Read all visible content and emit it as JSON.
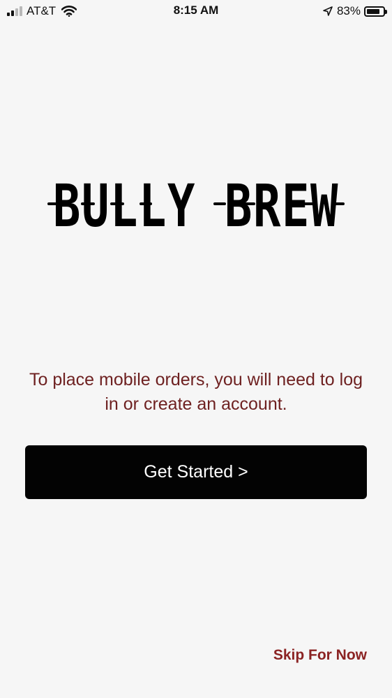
{
  "status_bar": {
    "carrier": "AT&T",
    "time": "8:15 AM",
    "battery_percent": "83%",
    "battery_level": 0.83,
    "signal_bars_active": 2,
    "signal_bars_total": 4,
    "icons": [
      "signal-icon",
      "wifi-icon",
      "location-arrow-icon",
      "battery-icon"
    ]
  },
  "logo": {
    "text": "BULLY BREW"
  },
  "onboarding": {
    "message": "To place mobile orders, you will need to log in or create an account.",
    "cta_label": "Get Started >",
    "skip_label": "Skip For Now"
  },
  "colors": {
    "background": "#f6f6f6",
    "message_text": "#6e2121",
    "button_bg": "#030303",
    "button_text": "#ffffff",
    "skip_text": "#8b2323"
  }
}
